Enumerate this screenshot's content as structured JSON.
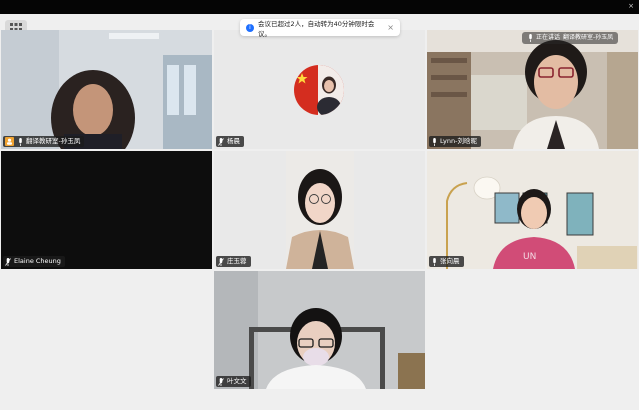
{
  "window": {
    "close_label": "×"
  },
  "notice": {
    "text": "会议已超过2人，自动转为40分钟限时会议。",
    "info_icon": "info-icon",
    "close_label": "×"
  },
  "speaking_indicator": {
    "label": "正在讲话",
    "name": "翻译教研室-孙玉凤"
  },
  "participants": [
    {
      "name": "翻译教研室-孙玉凤",
      "host": true,
      "mic": "on"
    },
    {
      "name": "杨晨",
      "mic": "muted"
    },
    {
      "name": "Lynn-刘晗昵",
      "mic": "on"
    },
    {
      "name": "Elaine Cheung",
      "mic": "muted"
    },
    {
      "name": "庄玉蓉",
      "mic": "muted"
    },
    {
      "name": "张向晨",
      "mic": "on"
    },
    {
      "name": "叶文文",
      "mic": "muted"
    }
  ],
  "colors": {
    "active_border": "#6fd38a",
    "host_badge": "#f0a332",
    "namebar_bg": "#1c1c1c",
    "notice_info": "#1e6fff"
  }
}
